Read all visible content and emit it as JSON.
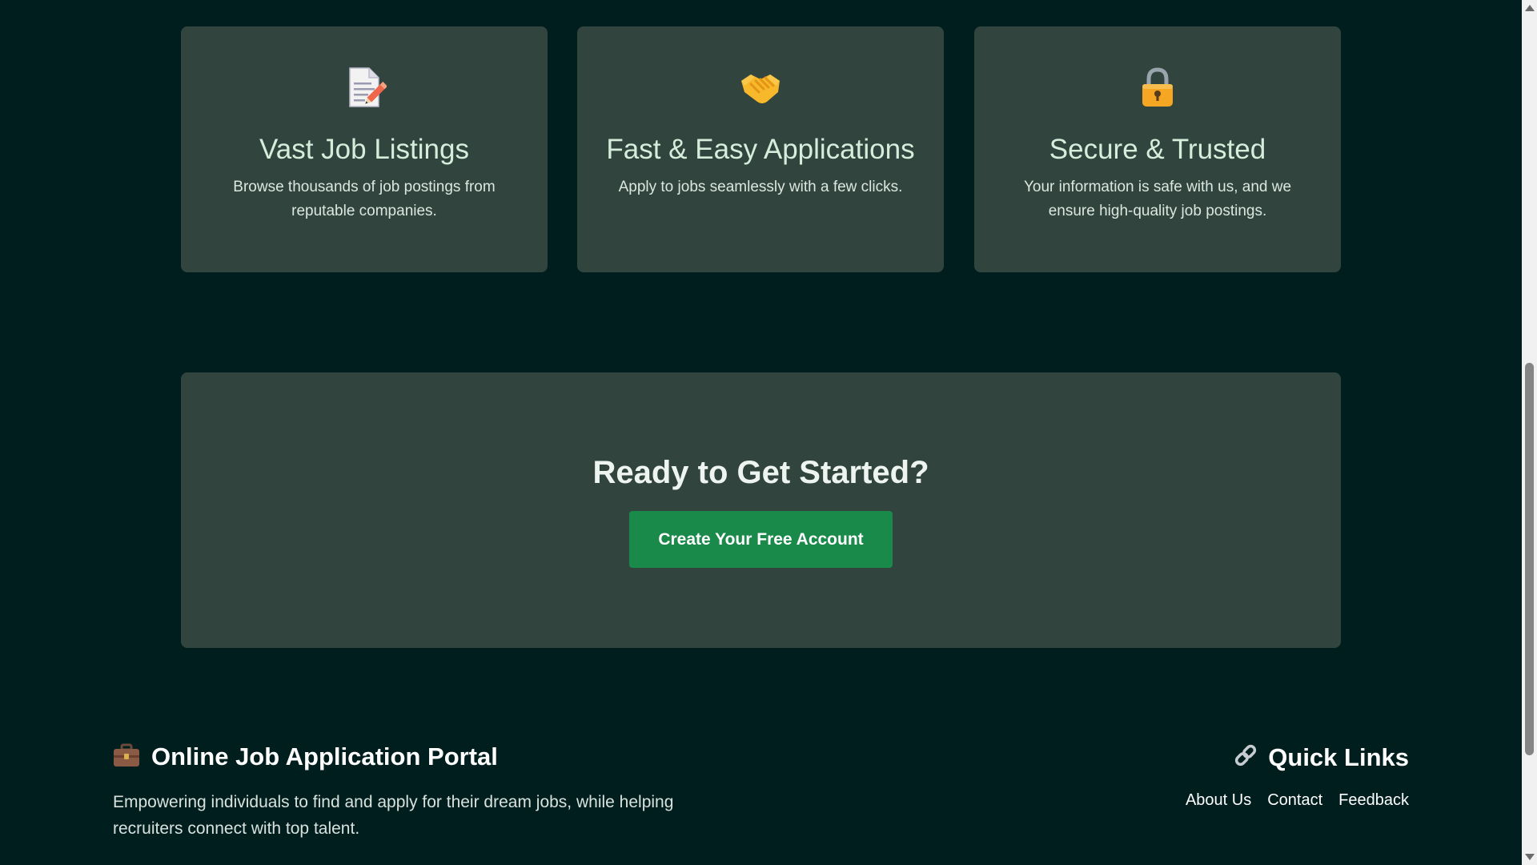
{
  "features": [
    {
      "icon": "memo-icon",
      "title": "Vast Job Listings",
      "description": "Browse thousands of job postings from reputable companies."
    },
    {
      "icon": "handshake-icon",
      "title": "Fast & Easy Applications",
      "description": "Apply to jobs seamlessly with a few clicks."
    },
    {
      "icon": "lock-icon",
      "title": "Secure & Trusted",
      "description": "Your information is safe with us, and we ensure high-quality job postings."
    }
  ],
  "cta": {
    "title": "Ready to Get Started?",
    "button_label": "Create Your Free Account"
  },
  "footer": {
    "brand_title": "Online Job Application Portal",
    "brand_icon": "briefcase-icon",
    "description": "Empowering individuals to find and apply for their dream jobs, while helping recruiters connect with top talent.",
    "quick_links_title": "Quick Links",
    "quick_links_icon": "link-icon",
    "links": [
      "About Us",
      "Contact",
      "Feedback"
    ]
  },
  "colors": {
    "background": "#011e1f",
    "card": "#31443e",
    "accent_button": "#1a8a4a"
  }
}
